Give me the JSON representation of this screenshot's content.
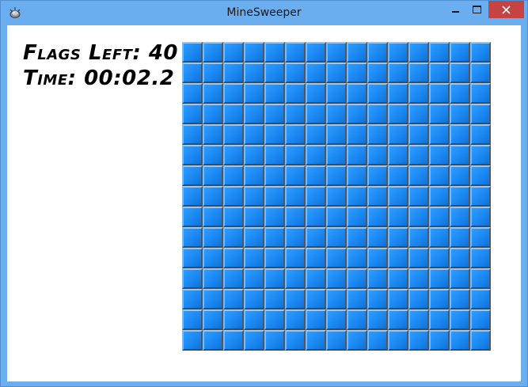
{
  "window": {
    "title": "MineSweeper",
    "app_icon": "mine-icon",
    "controls": {
      "minimize": "minimize-icon",
      "maximize": "maximize-icon",
      "close": "close-icon",
      "close_color": "#c74343"
    },
    "title_bar_color": "#6aaef0"
  },
  "hud": {
    "flags_left": "Flags Left: 40",
    "time": "Time: 00:02.2"
  },
  "board": {
    "rows": 15,
    "columns": 15,
    "cell_state": "covered",
    "cell_color": "#1b88f2"
  }
}
